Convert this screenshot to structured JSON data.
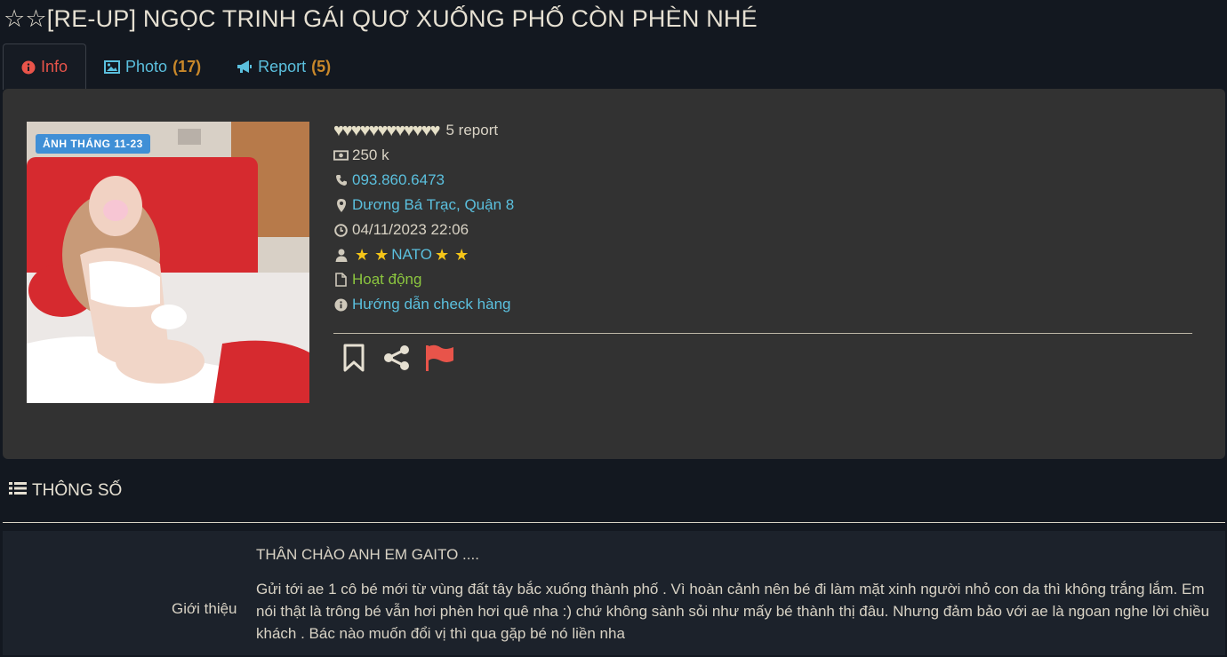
{
  "page": {
    "title": "☆☆[RE-UP] NGỌC TRINH GÁI QUƠ XUỐNG PHỐ CÒN PHÈN NHÉ"
  },
  "tabs": [
    {
      "label": "Info",
      "count": "",
      "icon": "info-circle-icon"
    },
    {
      "label": "Photo",
      "count": "(17)",
      "icon": "image-icon"
    },
    {
      "label": "Report",
      "count": "(5)",
      "icon": "megaphone-icon"
    }
  ],
  "profile": {
    "photo_badge": "ẢNH THÁNG 11-23",
    "hearts": "♥♥♥♥♥♥♥♥♥♥♥♥",
    "report_count": "5 report",
    "price": "250 k",
    "phone": "093.860.6473",
    "location": "Dương Bá Trạc, Quận 8",
    "datetime": "04/11/2023 22:06",
    "poster": "NATO",
    "status": "Hoạt động",
    "guide": "Hướng dẫn check hàng"
  },
  "colors": {
    "accent_link": "#5bc0de",
    "active_tab": "#e8544a",
    "count": "#c9882a",
    "status_green": "#8cc63f",
    "star": "#f5c518",
    "flag": "#e8544a"
  },
  "specs": {
    "heading": "THÔNG SỐ",
    "intro_label": "Giới thiệu",
    "intro_lines": [
      "THÂN CHÀO ANH EM GAITO ....",
      "Gửi tới ae 1 cô bé mới từ vùng đất tây bắc xuống thành phố . Vì hoàn cảnh nên bé đi làm mặt xinh người nhỏ con da thì không trắng lắm. Em nói thật là trông bé vẫn hơi phèn hơi quê nha :) chứ không sành sỏi như mấy bé thành thị đâu. Nhưng đảm bảo với ae là ngoan nghe lời chiều khách . Bác nào muốn đổi vị thì qua gặp bé nó liền nha"
    ]
  }
}
